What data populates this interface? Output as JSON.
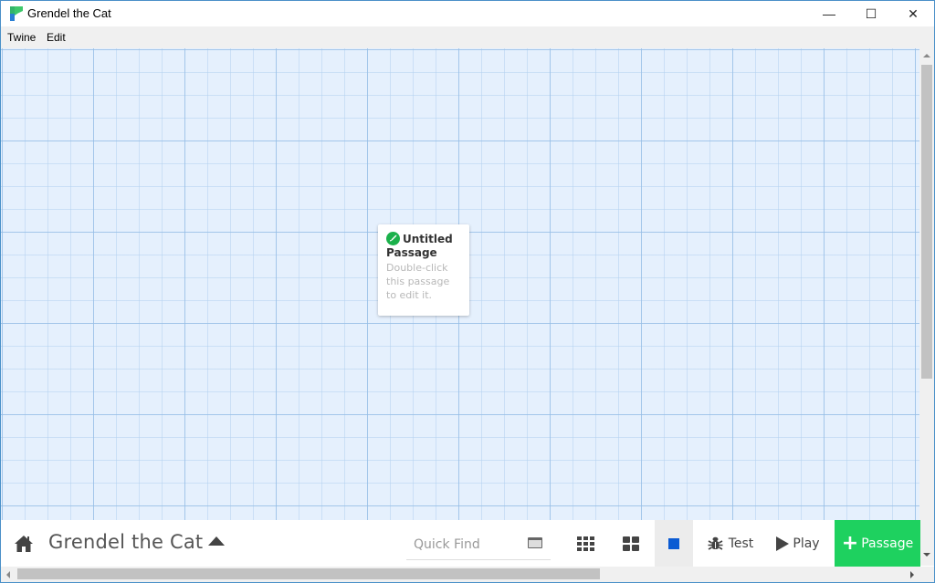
{
  "window": {
    "title": "Grendel the Cat",
    "controls": {
      "minimize": "—",
      "maximize": "☐",
      "close": "✕"
    }
  },
  "menubar": {
    "items": [
      {
        "label": "Twine"
      },
      {
        "label": "Edit"
      }
    ]
  },
  "canvas": {
    "passages": [
      {
        "title": "Untitled Passage",
        "is_start": true,
        "start_icon": "rocket-icon",
        "excerpt": "Double-click this passage to edit it."
      }
    ]
  },
  "toolbar": {
    "home_icon": "home-icon",
    "story_title": "Grendel the Cat",
    "story_menu_icon": "caret-up-icon",
    "quick_find": {
      "value": "",
      "placeholder": "Quick Find"
    },
    "highlight_icon": "highlight-passages-icon",
    "zoom_buttons": [
      {
        "name": "zoom-small",
        "icon": "grid-9-icon"
      },
      {
        "name": "zoom-medium",
        "icon": "grid-4-icon"
      },
      {
        "name": "zoom-large",
        "icon": "square-icon",
        "active": true
      }
    ],
    "test_label": "Test",
    "test_icon": "bug-icon",
    "play_label": "Play",
    "play_icon": "play-icon",
    "passage_label": "Passage",
    "passage_icon": "plus-icon",
    "colors": {
      "passage_button": "#1ed15f",
      "active_zoom": "#0b5bd3",
      "start_icon": "#1bb14b"
    }
  },
  "scrollbars": {
    "vertical": {
      "position_fraction": 0.0,
      "visible_fraction": 0.65
    },
    "horizontal": {
      "position_fraction": 0.0,
      "visible_fraction": 0.65
    }
  }
}
